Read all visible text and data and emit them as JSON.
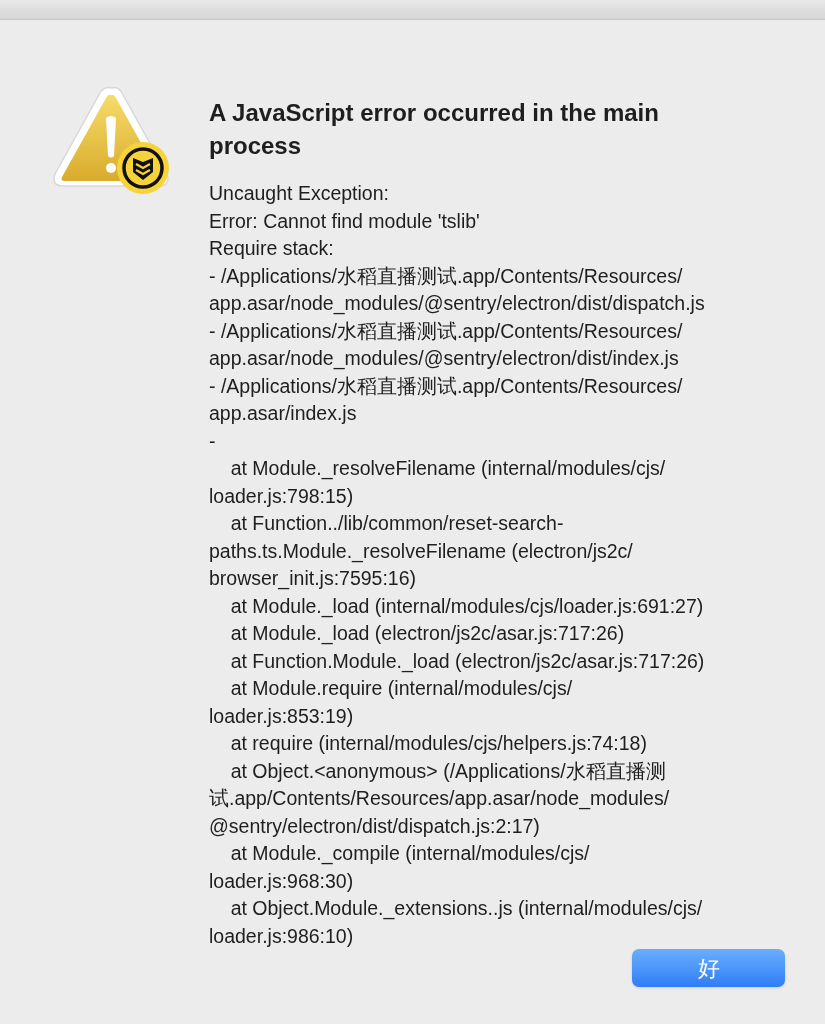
{
  "dialog": {
    "title": "A JavaScript error occurred in the main process",
    "message_lines": [
      "Uncaught Exception:",
      "Error: Cannot find module 'tslib'",
      "Require stack:",
      "- /Applications/水稻直播测试.app/Contents/Resources/",
      "app.asar/node_modules/@sentry/electron/dist/dispatch.js",
      "- /Applications/水稻直播测试.app/Contents/Resources/",
      "app.asar/node_modules/@sentry/electron/dist/index.js",
      "- /Applications/水稻直播测试.app/Contents/Resources/",
      "app.asar/index.js",
      "-",
      "    at Module._resolveFilename (internal/modules/cjs/",
      "loader.js:798:15)",
      "    at Function../lib/common/reset-search-",
      "paths.ts.Module._resolveFilename (electron/js2c/",
      "browser_init.js:7595:16)",
      "    at Module._load (internal/modules/cjs/loader.js:691:27)",
      "    at Module._load (electron/js2c/asar.js:717:26)",
      "    at Function.Module._load (electron/js2c/asar.js:717:26)",
      "    at Module.require (internal/modules/cjs/",
      "loader.js:853:19)",
      "    at require (internal/modules/cjs/helpers.js:74:18)",
      "    at Object.<anonymous> (/Applications/水稻直播测",
      "试.app/Contents/Resources/app.asar/node_modules/",
      "@sentry/electron/dist/dispatch.js:2:17)",
      "    at Module._compile (internal/modules/cjs/",
      "loader.js:968:30)",
      "    at Object.Module._extensions..js (internal/modules/cjs/",
      "loader.js:986:10)"
    ],
    "buttons": [
      {
        "label": "好",
        "default": true
      }
    ]
  }
}
